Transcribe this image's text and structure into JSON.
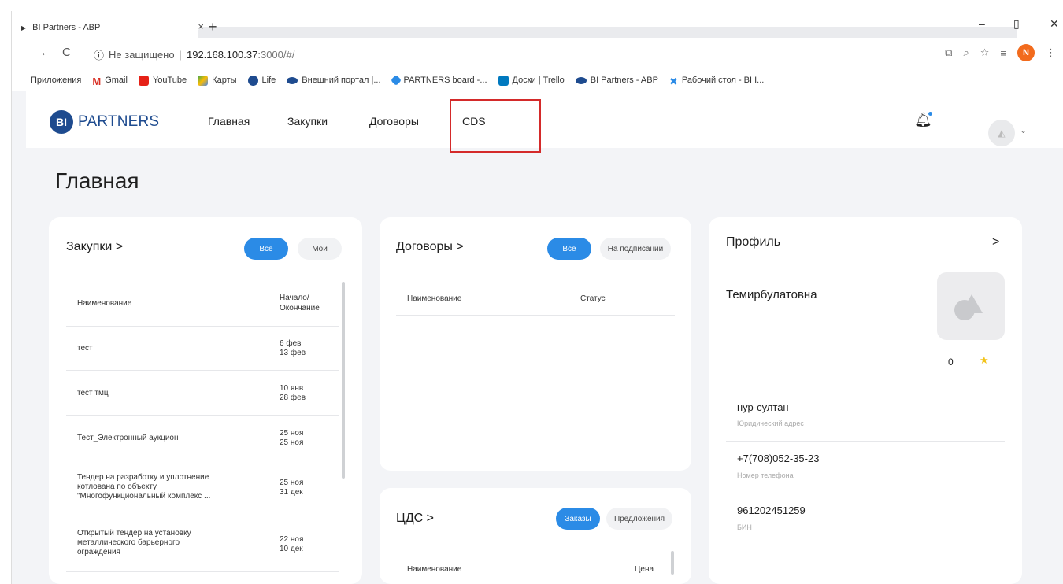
{
  "browser": {
    "tab_title": "BI Partners - ABP",
    "tab_close": "×",
    "new_tab": "+",
    "url_insecure": "Не защищено",
    "url_host": "192.168.100.37",
    "url_path": ":3000/#/",
    "profile_initial": "N",
    "bookmarks": [
      "Приложения",
      "Gmail",
      "YouTube",
      "Карты",
      "Life",
      "Внешний портал |...",
      "PARTNERS board -...",
      "Доски | Trello",
      "BI Partners - ABP",
      "Рабочий стол - BI I..."
    ]
  },
  "header": {
    "logo_badge": "BI",
    "logo_text": "PARTNERS",
    "nav": [
      "Главная",
      "Закупки",
      "Договоры",
      "CDS"
    ],
    "highlight_color": "#d42a2a"
  },
  "page": {
    "title": "Главная"
  },
  "purchases": {
    "title": "Закупки >",
    "filter_all": "Все",
    "filter_mine": "Мои",
    "col_name": "Наименование",
    "col_dates_1": "Начало/",
    "col_dates_2": "Окончание",
    "rows": [
      {
        "name1": "тест",
        "name2": "",
        "name3": "",
        "d1": "6 фев",
        "d2": "13 фев"
      },
      {
        "name1": "тест тмц",
        "name2": "",
        "name3": "",
        "d1": "10 янв",
        "d2": "28 фев"
      },
      {
        "name1": "Тест_Электронный аукцион",
        "name2": "",
        "name3": "",
        "d1": "25 ноя",
        "d2": "25 ноя"
      },
      {
        "name1": "Тендер на разработку и уплотнение",
        "name2": "котлована по объекту",
        "name3": "\"Многофункциональный комплекс ...",
        "d1": "25 ноя",
        "d2": "31 дек"
      },
      {
        "name1": "Открытый тендер на установку",
        "name2": "металлического барьерного",
        "name3": "ограждения",
        "d1": "22 ноя",
        "d2": "10 дек"
      }
    ]
  },
  "contracts": {
    "title": "Договоры >",
    "filter_all": "Все",
    "filter_signing": "На подписании",
    "col_name": "Наименование",
    "col_status": "Статус"
  },
  "cds": {
    "title": "ЦДС >",
    "filter_orders": "Заказы",
    "filter_offers": "Предложения",
    "col_name": "Наименование",
    "col_price": "Цена"
  },
  "profile": {
    "title": "Профиль",
    "chevron": ">",
    "name": "Темирбулатовна",
    "count": "0",
    "star": "★",
    "city": "нур-султан",
    "city_label": "Юридический адрес",
    "phone": "+7(708)052-35-23",
    "phone_label": "Номер телефона",
    "bin": "961202451259",
    "bin_label": "БИН"
  },
  "colors": {
    "accent": "#2b8be6",
    "brand": "#1e4b8f",
    "background": "#f3f4f7"
  }
}
